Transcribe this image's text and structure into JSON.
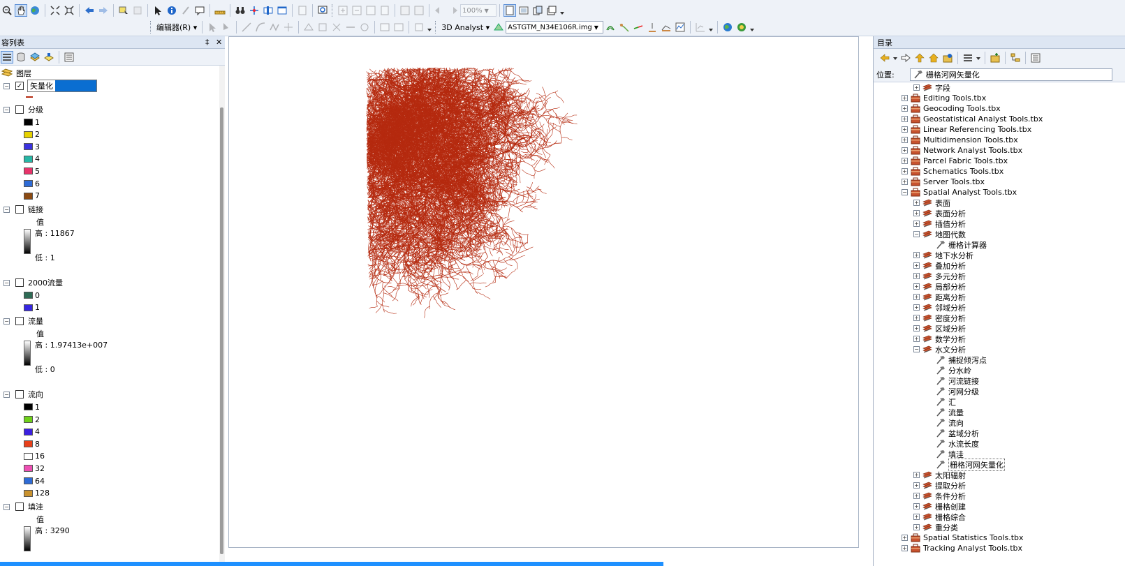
{
  "toolbar": {
    "zoom_value": "100%",
    "editor_label": "编辑器(R)",
    "analyst_label": "3D Analyst",
    "layer_combo": "ASTGTM_N34E106R.img"
  },
  "toc": {
    "title": "容列表",
    "pin_glyph": "‡",
    "close_glyph": "✕",
    "root": "图层",
    "rename_value": "矢量化",
    "groups": [
      {
        "label": "分级",
        "checked": false,
        "type": "classes",
        "classes": [
          {
            "label": "1",
            "color": "#000000"
          },
          {
            "label": "2",
            "color": "#e6d200"
          },
          {
            "label": "3",
            "color": "#3b32e0"
          },
          {
            "label": "4",
            "color": "#27b7a6"
          },
          {
            "label": "5",
            "color": "#e8336a"
          },
          {
            "label": "6",
            "color": "#2e6bd6"
          },
          {
            "label": "7",
            "color": "#8b4a12"
          }
        ]
      },
      {
        "label": "链接",
        "checked": false,
        "type": "stretch",
        "value_label": "值",
        "high": "高 : 11867",
        "low": "低 : 1"
      },
      {
        "label": "2000流量",
        "checked": false,
        "type": "classes",
        "classes": [
          {
            "label": "0",
            "color": "#2e6b55"
          },
          {
            "label": "1",
            "color": "#3626e0"
          }
        ]
      },
      {
        "label": "流量",
        "checked": false,
        "type": "stretch",
        "value_label": "值",
        "high": "高 : 1.97413e+007",
        "low": "低 : 0"
      },
      {
        "label": "流向",
        "checked": false,
        "type": "classes",
        "classes": [
          {
            "label": "1",
            "color": "#000000"
          },
          {
            "label": "2",
            "color": "#6fd11a"
          },
          {
            "label": "4",
            "color": "#3b1fe0"
          },
          {
            "label": "8",
            "color": "#e8401a"
          },
          {
            "label": "16",
            "color": "#ffffff"
          },
          {
            "label": "32",
            "color": "#ee4fb4"
          },
          {
            "label": "64",
            "color": "#2e6bd6"
          },
          {
            "label": "128",
            "color": "#c9922e"
          }
        ]
      },
      {
        "label": "填洼",
        "checked": false,
        "type": "stretch",
        "value_label": "值",
        "high": "高 : 3290",
        "low": ""
      }
    ]
  },
  "catalog": {
    "title": "目录",
    "location_label": "位置:",
    "location_value": "栅格河网矢量化",
    "tree": [
      {
        "label": "字段",
        "level": 2,
        "kind": "toolset",
        "exp": "+"
      },
      {
        "label": "Editing Tools.tbx",
        "level": 1,
        "kind": "toolbox",
        "exp": "+"
      },
      {
        "label": "Geocoding Tools.tbx",
        "level": 1,
        "kind": "toolbox",
        "exp": "+"
      },
      {
        "label": "Geostatistical Analyst Tools.tbx",
        "level": 1,
        "kind": "toolbox",
        "exp": "+"
      },
      {
        "label": "Linear Referencing Tools.tbx",
        "level": 1,
        "kind": "toolbox",
        "exp": "+"
      },
      {
        "label": "Multidimension Tools.tbx",
        "level": 1,
        "kind": "toolbox",
        "exp": "+"
      },
      {
        "label": "Network Analyst Tools.tbx",
        "level": 1,
        "kind": "toolbox",
        "exp": "+"
      },
      {
        "label": "Parcel Fabric Tools.tbx",
        "level": 1,
        "kind": "toolbox",
        "exp": "+"
      },
      {
        "label": "Schematics Tools.tbx",
        "level": 1,
        "kind": "toolbox",
        "exp": "+"
      },
      {
        "label": "Server Tools.tbx",
        "level": 1,
        "kind": "toolbox",
        "exp": "+"
      },
      {
        "label": "Spatial Analyst Tools.tbx",
        "level": 1,
        "kind": "toolbox",
        "exp": "-"
      },
      {
        "label": "表面",
        "level": 2,
        "kind": "toolset",
        "exp": "+"
      },
      {
        "label": "表面分析",
        "level": 2,
        "kind": "toolset",
        "exp": "+"
      },
      {
        "label": "插值分析",
        "level": 2,
        "kind": "toolset",
        "exp": "+"
      },
      {
        "label": "地图代数",
        "level": 2,
        "kind": "toolset",
        "exp": "-"
      },
      {
        "label": "栅格计算器",
        "level": 3,
        "kind": "tool",
        "exp": ""
      },
      {
        "label": "地下水分析",
        "level": 2,
        "kind": "toolset",
        "exp": "+"
      },
      {
        "label": "叠加分析",
        "level": 2,
        "kind": "toolset",
        "exp": "+"
      },
      {
        "label": "多元分析",
        "level": 2,
        "kind": "toolset",
        "exp": "+"
      },
      {
        "label": "局部分析",
        "level": 2,
        "kind": "toolset",
        "exp": "+"
      },
      {
        "label": "距离分析",
        "level": 2,
        "kind": "toolset",
        "exp": "+"
      },
      {
        "label": "邻域分析",
        "level": 2,
        "kind": "toolset",
        "exp": "+"
      },
      {
        "label": "密度分析",
        "level": 2,
        "kind": "toolset",
        "exp": "+"
      },
      {
        "label": "区域分析",
        "level": 2,
        "kind": "toolset",
        "exp": "+"
      },
      {
        "label": "数学分析",
        "level": 2,
        "kind": "toolset",
        "exp": "+"
      },
      {
        "label": "水文分析",
        "level": 2,
        "kind": "toolset",
        "exp": "-"
      },
      {
        "label": "捕捉倾泻点",
        "level": 3,
        "kind": "tool",
        "exp": ""
      },
      {
        "label": "分水岭",
        "level": 3,
        "kind": "tool",
        "exp": ""
      },
      {
        "label": "河流链接",
        "level": 3,
        "kind": "tool",
        "exp": ""
      },
      {
        "label": "河网分级",
        "level": 3,
        "kind": "tool",
        "exp": ""
      },
      {
        "label": "汇",
        "level": 3,
        "kind": "tool",
        "exp": ""
      },
      {
        "label": "流量",
        "level": 3,
        "kind": "tool",
        "exp": ""
      },
      {
        "label": "流向",
        "level": 3,
        "kind": "tool",
        "exp": ""
      },
      {
        "label": "盆域分析",
        "level": 3,
        "kind": "tool",
        "exp": ""
      },
      {
        "label": "水流长度",
        "level": 3,
        "kind": "tool",
        "exp": ""
      },
      {
        "label": "填洼",
        "level": 3,
        "kind": "tool",
        "exp": ""
      },
      {
        "label": "栅格河网矢量化",
        "level": 3,
        "kind": "tool",
        "exp": "",
        "selected": true
      },
      {
        "label": "太阳辐射",
        "level": 2,
        "kind": "toolset",
        "exp": "+"
      },
      {
        "label": "提取分析",
        "level": 2,
        "kind": "toolset",
        "exp": "+"
      },
      {
        "label": "条件分析",
        "level": 2,
        "kind": "toolset",
        "exp": "+"
      },
      {
        "label": "栅格创建",
        "level": 2,
        "kind": "toolset",
        "exp": "+"
      },
      {
        "label": "栅格综合",
        "level": 2,
        "kind": "toolset",
        "exp": "+"
      },
      {
        "label": "重分类",
        "level": 2,
        "kind": "toolset",
        "exp": "+"
      },
      {
        "label": "Spatial Statistics Tools.tbx",
        "level": 1,
        "kind": "toolbox",
        "exp": "+"
      },
      {
        "label": "Tracking Analyst Tools.tbx",
        "level": 1,
        "kind": "toolbox",
        "exp": "+"
      }
    ]
  },
  "map": {
    "stream_color": "#b52a0f"
  }
}
